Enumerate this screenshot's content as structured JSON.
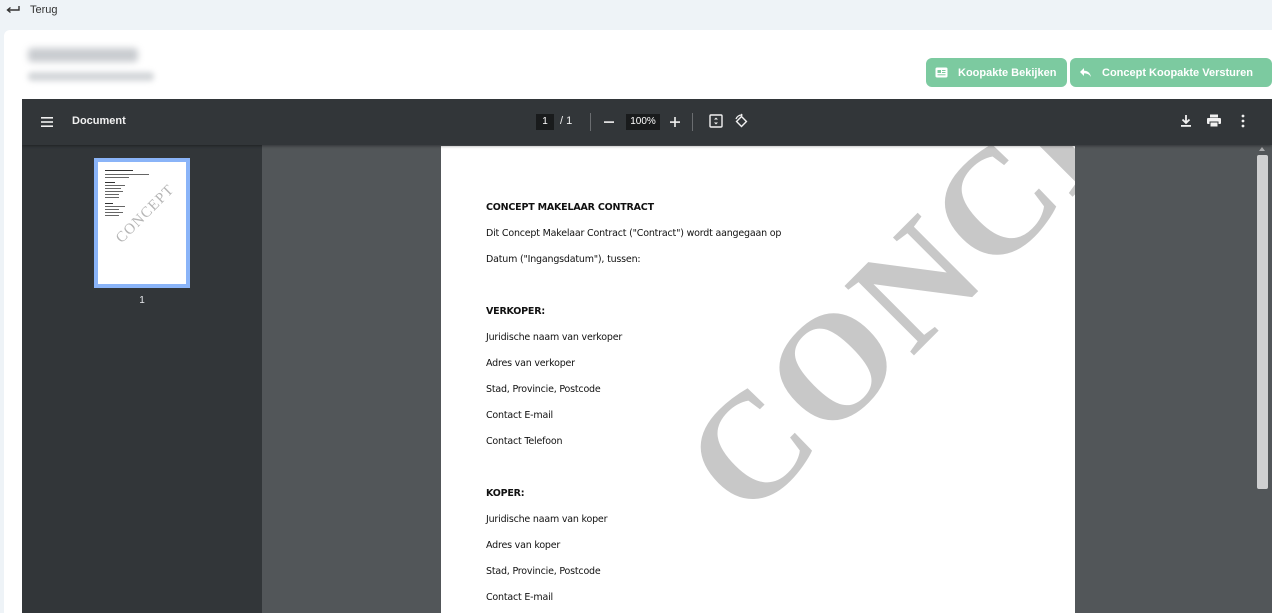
{
  "nav": {
    "back_label": "Terug"
  },
  "header": {
    "view_button": "Koopakte Bekijken",
    "send_button": "Concept Koopakte Versturen",
    "button_color": "#7ccaa0"
  },
  "viewer": {
    "title": "Document",
    "current_page": "1",
    "page_separator": "/",
    "total_pages": "1",
    "zoom": "100%",
    "thumbnail_page_number": "1"
  },
  "document": {
    "watermark": "CONCEPT",
    "lines": [
      {
        "text": "CONCEPT MAKELAAR CONTRACT",
        "bold": true
      },
      {
        "text": "Dit Concept Makelaar Contract (\"Contract\") wordt aangegaan op",
        "bold": false
      },
      {
        "text": "Datum (\"Ingangsdatum\"), tussen:",
        "bold": false
      },
      {
        "text": "VERKOPER:",
        "bold": true
      },
      {
        "text": "Juridische naam van verkoper",
        "bold": false
      },
      {
        "text": "Adres van verkoper",
        "bold": false
      },
      {
        "text": "Stad, Provincie, Postcode",
        "bold": false
      },
      {
        "text": "Contact E-mail",
        "bold": false
      },
      {
        "text": "Contact Telefoon",
        "bold": false
      },
      {
        "text": "KOPER:",
        "bold": true
      },
      {
        "text": "Juridische naam van koper",
        "bold": false
      },
      {
        "text": "Adres van koper",
        "bold": false
      },
      {
        "text": "Stad, Provincie, Postcode",
        "bold": false
      },
      {
        "text": "Contact E-mail",
        "bold": false
      }
    ]
  },
  "icons": {
    "back": "arrow-return-left-icon",
    "view": "newspaper-icon",
    "send": "reply-icon",
    "menu": "hamburger-menu-icon",
    "fit": "fit-to-page-icon",
    "rotate": "rotate-icon",
    "download": "download-icon",
    "print": "print-icon",
    "more": "more-vertical-icon"
  }
}
